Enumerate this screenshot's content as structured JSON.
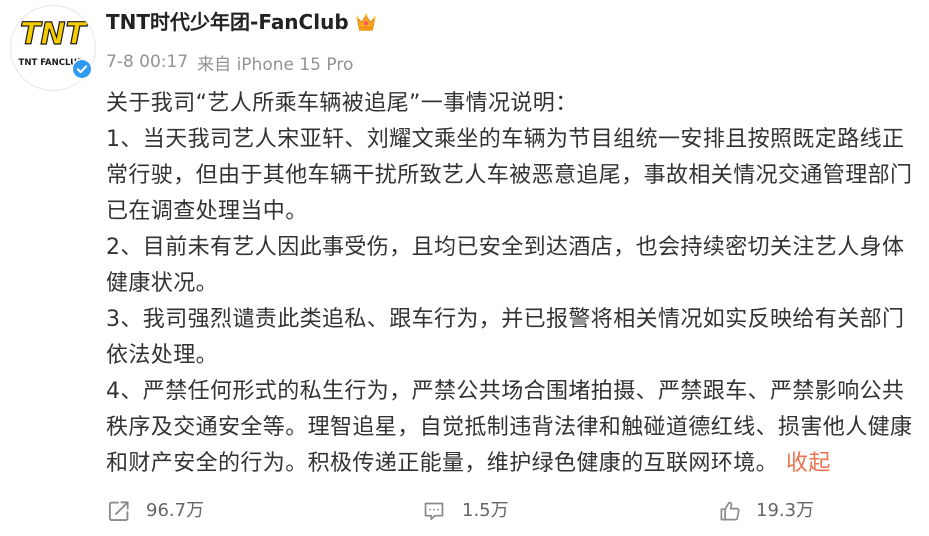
{
  "post": {
    "author": {
      "name": "TNT时代少年团-FanClub",
      "avatar_logo": "TNT",
      "avatar_subtext": "TNT FANCLUB",
      "verified_icon": "verified-badge-icon",
      "vip_icon": "crown-icon"
    },
    "time": "7-8 00:17",
    "source": "来自 iPhone 15 Pro",
    "body": {
      "lines": [
        "关于我司“艺人所乘车辆被追尾”一事情况说明：",
        "1、当天我司艺人宋亚轩、刘耀文乘坐的车辆为节目组统一安排且按照既定路线正",
        "常行驶，但由于其他车辆干扰所致艺人车被恶意追尾，事故相关情况交通管理部门",
        "已在调查处理当中。",
        "2、目前未有艺人因此事受伤，且均已安全到达酒店，也会持续密切关注艺人身体",
        "健康状况。",
        "3、我司强烈谴责此类追私、跟车行为，并已报警将相关情况如实反映给有关部门",
        "依法处理。",
        "4、严禁任何形式的私生行为，严禁公共场合围堵拍摄、严禁跟车、严禁影响公共",
        "秩序及交通安全等。理智追星，自觉抵制违背法律和触碰道德红线、损害他人健康",
        "和财产安全的行为。积极传递正能量，维护绿色健康的互联网环境。"
      ],
      "collapse_label": "收起"
    },
    "actions": {
      "share": {
        "icon": "share-icon",
        "count": "96.7万"
      },
      "comment": {
        "icon": "comment-icon",
        "count": "1.5万"
      },
      "like": {
        "icon": "like-icon",
        "count": "19.3万"
      }
    }
  },
  "colors": {
    "background": "#ffffff",
    "text": "#333333",
    "meta": "#939393",
    "link": "#eb7350",
    "action_text": "#666666",
    "icon": "#8a8a8a",
    "verified_badge": "#2f9bf0",
    "logo_yellow": "#f5cc00",
    "crown": "#f7a623"
  }
}
